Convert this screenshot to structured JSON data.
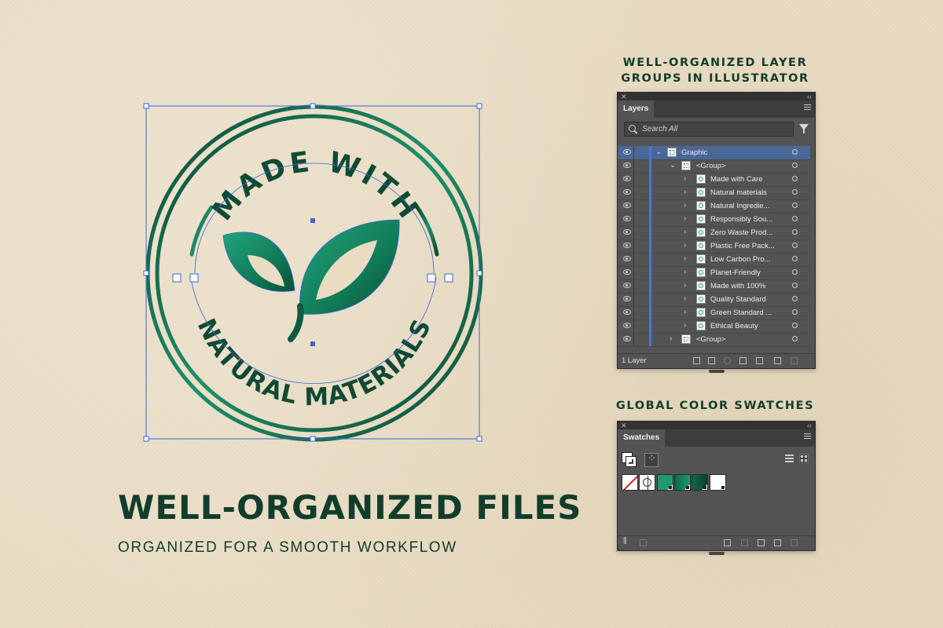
{
  "badge": {
    "top_text": "MADE WITH",
    "bottom_text": "NATURAL MATERIALS",
    "color_dark": "#0f4a36",
    "color_mid": "#1f8f6b",
    "color_light": "#22a57c",
    "selection_color": "#3a64d9"
  },
  "headline": "WELL-ORGANIZED FILES",
  "subline": "ORGANIZED FOR A SMOOTH WORKFLOW",
  "layers_caption": {
    "line1": "WELL-ORGANIZED LAYER",
    "line2": "GROUPS IN ILLUSTRATOR"
  },
  "swatches_caption": "GLOBAL COLOR SWATCHES",
  "layers_panel": {
    "tab_label": "Layers",
    "search_placeholder": "Search All",
    "top_layer": "Graphic",
    "group_label": "<Group>",
    "items": [
      "Made with Care",
      "Natural materials",
      "Natural Ingredie...",
      "Responsibly Sou...",
      "Zero Waste Prod...",
      "Plastic Free Pack...",
      "Low Carbon Pro...",
      "Planet-Friendly",
      "Made with 100%",
      "Quality Standard",
      "Green Standard ...",
      "Ethical Beauty"
    ],
    "bottom_group_label": "<Group>",
    "footer_text": "1 Layer",
    "row_highlight_color": "#4a6897",
    "layer_color": "#4b74d6"
  },
  "swatches_panel": {
    "tab_label": "Swatches",
    "swatch_colors": [
      "none",
      "registration",
      "#1f9a6e",
      "#0c6b4a",
      "#ffffff"
    ]
  }
}
